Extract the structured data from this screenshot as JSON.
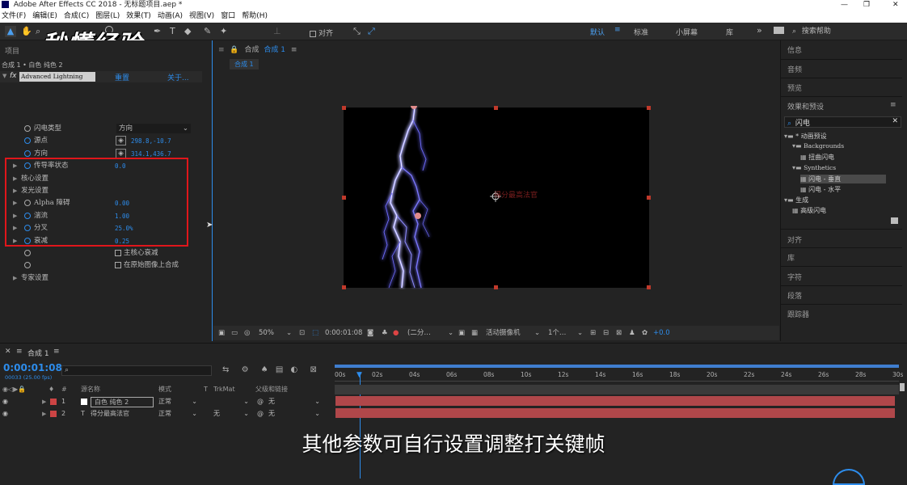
{
  "title": "Adobe After Effects CC 2018 - 无标题项目.aep *",
  "window_controls": {
    "minimize": "—",
    "maximize": "❐",
    "close": "✕"
  },
  "menu": [
    "文件(F)",
    "编辑(E)",
    "合成(C)",
    "图层(L)",
    "效果(T)",
    "动画(A)",
    "视图(V)",
    "窗口",
    "帮助(H)"
  ],
  "toolbar": {
    "align_label": "对齐",
    "workspaces": [
      "默认",
      "标准",
      "小屏幕",
      "库"
    ],
    "more": "»",
    "search_placeholder": "搜索帮助"
  },
  "watermark": "秒懂经验",
  "effects_panel": {
    "tab": "项目",
    "layer_path": "合成 1 • 白色 纯色 2",
    "fx_label": "fx",
    "effect_name": "Advanced Lightning",
    "reset": "重置",
    "about": "关于...",
    "props": [
      {
        "name": "闪电类型",
        "value": "方向",
        "kind": "select",
        "colored": false
      },
      {
        "name": "源点",
        "value": "298.8,-10.7",
        "kind": "point",
        "colored": true
      },
      {
        "name": "方向",
        "value": "314.1,436.7",
        "kind": "point",
        "colored": true
      },
      {
        "name": "传导率状态",
        "value": "0.0",
        "kind": "value",
        "colored": true,
        "expand": true
      },
      {
        "name": "核心设置",
        "value": "",
        "kind": "group",
        "colored": false,
        "expand": true
      },
      {
        "name": "发光设置",
        "value": "",
        "kind": "group",
        "colored": false,
        "expand": true
      },
      {
        "name": "Alpha 障碍",
        "value": "0.00",
        "kind": "value",
        "colored": false,
        "expand": true
      },
      {
        "name": "湍流",
        "value": "1.00",
        "kind": "value",
        "colored": true,
        "expand": true
      },
      {
        "name": "分叉",
        "value": "25.0%",
        "kind": "value",
        "colored": true,
        "expand": true
      },
      {
        "name": "衰减",
        "value": "0.25",
        "kind": "value",
        "colored": true,
        "expand": true
      },
      {
        "name": "",
        "value": "主核心衰减",
        "kind": "checkbox",
        "colored": false
      },
      {
        "name": "",
        "value": "在原始图像上合成",
        "kind": "checkbox",
        "colored": false
      },
      {
        "name": "专家设置",
        "value": "",
        "kind": "group",
        "colored": false,
        "expand": true
      }
    ]
  },
  "composition_panel": {
    "tab": "合成",
    "tab_name": "合成 1",
    "sub_tab": "合成 1",
    "overlay_text": "得分最高法官",
    "zoom": "50%",
    "timecode": "0:00:01:08",
    "resolution": "(二分…",
    "camera": "活动摄像机",
    "views": "1个…",
    "exposure": "+0.0"
  },
  "right_panel": {
    "top_items": [
      "信息",
      "音频",
      "预览"
    ],
    "effects_title": "效果和预设",
    "search_value": "闪电",
    "tree": [
      {
        "label": "* 动画预设",
        "level": 0,
        "type": "folder"
      },
      {
        "label": "Backgrounds",
        "level": 1,
        "type": "folder"
      },
      {
        "label": "扭曲闪电",
        "level": 2,
        "type": "item"
      },
      {
        "label": "Synthetics",
        "level": 1,
        "type": "folder"
      },
      {
        "label": "闪电 - 垂直",
        "level": 2,
        "type": "item",
        "selected": true
      },
      {
        "label": "闪电 - 水平",
        "level": 2,
        "type": "item"
      },
      {
        "label": "生成",
        "level": 0,
        "type": "folder"
      },
      {
        "label": "高级闪电",
        "level": 1,
        "type": "item"
      }
    ],
    "bottom_items": [
      "对齐",
      "库",
      "字符",
      "段落",
      "跟踪器"
    ]
  },
  "timeline": {
    "tab": "合成 1",
    "timecode": "0:00:01:08",
    "frame_info": "00033 (25.00 fps)",
    "columns": {
      "num": "#",
      "source": "源名称",
      "mode": "模式",
      "t": "T",
      "trkmat": "TrkMat",
      "parent": "父级和链接"
    },
    "layers": [
      {
        "num": "1",
        "name": "白色 纯色 2",
        "type": "solid",
        "mode": "正常",
        "trkmat": "",
        "parent": "无"
      },
      {
        "num": "2",
        "name": "得分最高法官",
        "type": "text",
        "mode": "正常",
        "trkmat": "无",
        "parent": "无"
      }
    ],
    "ruler": [
      "00s",
      "02s",
      "04s",
      "06s",
      "08s",
      "10s",
      "12s",
      "14s",
      "16s",
      "18s",
      "20s",
      "22s",
      "24s",
      "26s",
      "28s",
      "30s"
    ]
  },
  "subtitle": "其他参数可自行设置调整打关键帧",
  "colors": {
    "accent": "#2d8ceb",
    "layer_bar": "#b0474a",
    "highlight_box": "#e0161b",
    "lightning": "#6f6cff"
  }
}
